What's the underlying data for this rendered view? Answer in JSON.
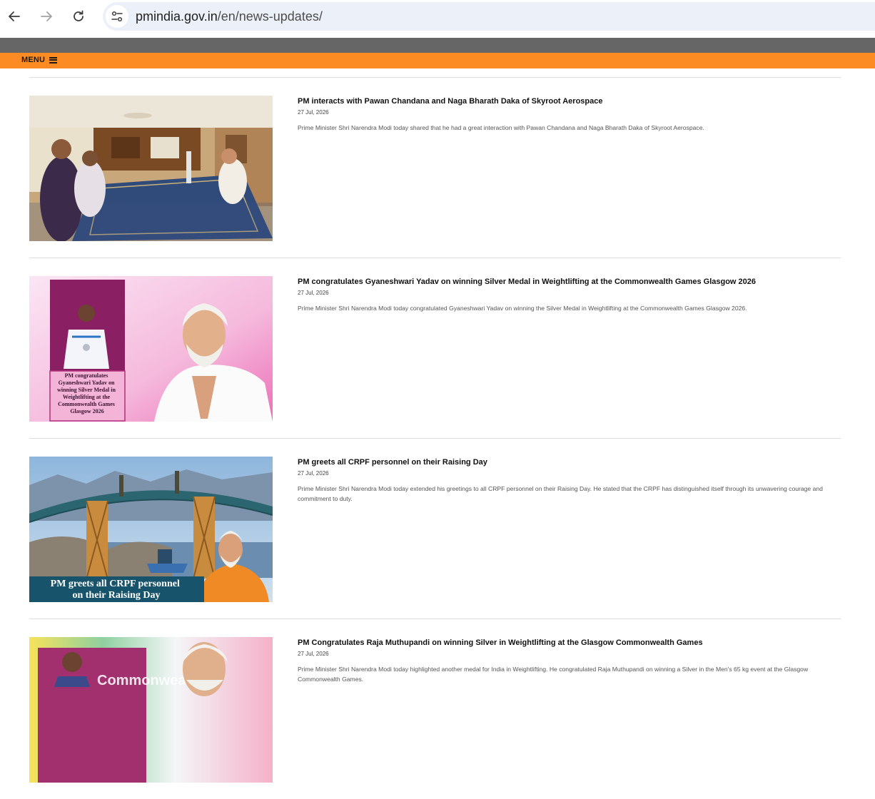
{
  "browser": {
    "url_domain": "pmindia.gov.in",
    "url_path": "/en/news-updates/"
  },
  "header": {
    "menu_label": "MENU"
  },
  "news": [
    {
      "title": "PM interacts with Pawan Chandana and Naga Bharath Daka of Skyroot Aerospace",
      "date": "27 Jul, 2026",
      "description": "Prime Minister Shri Narendra Modi today shared that he had a great interaction with Pawan Chandana and Naga Bharath Daka of Skyroot Aerospace."
    },
    {
      "title": "PM congratulates Gyaneshwari Yadav on winning Silver Medal in Weightlifting at the Commonwealth Games Glasgow 2026",
      "date": "27 Jul, 2026",
      "description": "Prime Minister Shri Narendra Modi today congratulated Gyaneshwari Yadav on winning the Silver Medal in Weightlifting at the Commonwealth Games Glasgow 2026.",
      "image_caption": "PM congratulates Gyaneshwari Yadav on winning Silver Medal in Weightlifting at the Commonwealth Games Glasgow 2026"
    },
    {
      "title": "PM greets all CRPF personnel on their Raising Day",
      "date": "27 Jul, 2026",
      "description": "Prime Minister Shri Narendra Modi today extended his greetings to all CRPF personnel on their Raising Day. He stated that the CRPF has distinguished itself through its unwavering courage and commitment to duty.",
      "image_caption_line1": "PM greets all CRPF personnel",
      "image_caption_line2": "on their Raising Day"
    },
    {
      "title": "PM Congratulates Raja Muthupandi on winning Silver in Weightlifting at the Glasgow Commonwealth Games",
      "date": "27 Jul, 2026",
      "description": "Prime Minister Shri Narendra Modi today highlighted another medal for India in Weightlifting. He congratulated Raja Muthupandi on winning a Silver in the Men's 65 kg event at the Glasgow Commonwealth Games.",
      "image_banner": "Commonwealth"
    }
  ],
  "colors": {
    "menu_bar": "#fd8b23",
    "header_strip": "#666666"
  }
}
